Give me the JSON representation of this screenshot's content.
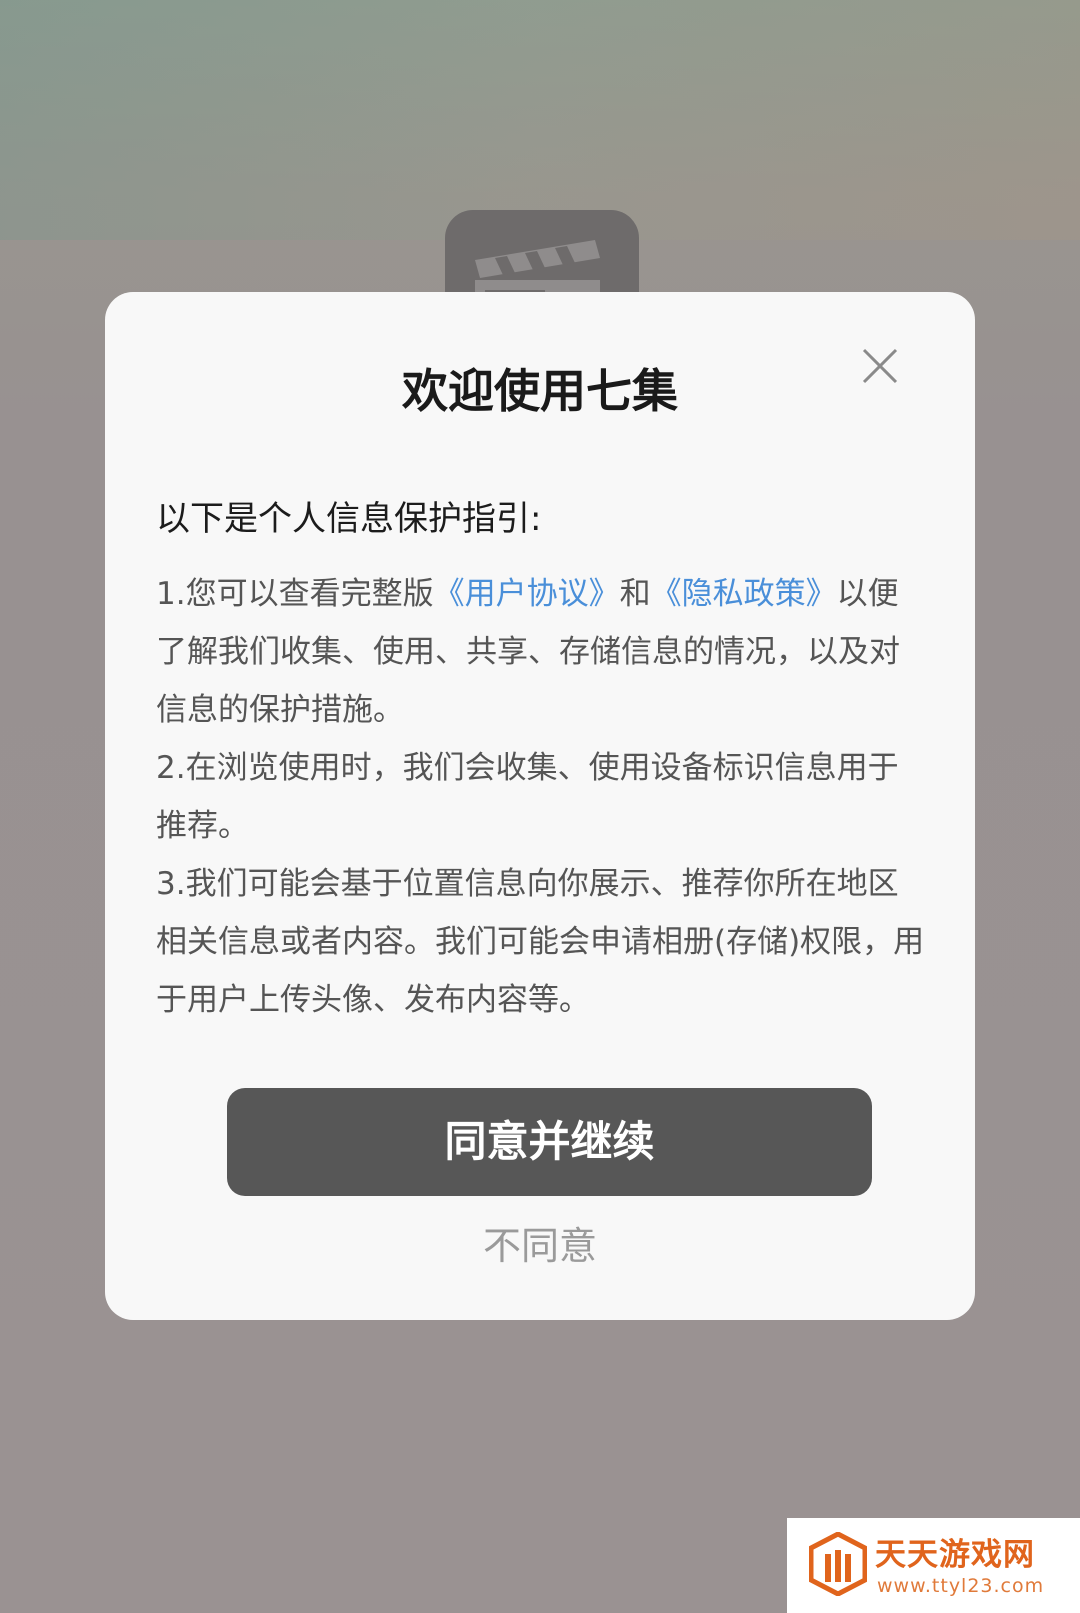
{
  "dialog": {
    "title": "欢迎使用七集",
    "close_icon": "close-icon",
    "intro": "以下是个人信息保护指引:",
    "item1": {
      "prefix": "1.您可以查看完整版",
      "user_agreement_link": "《用户协议》",
      "and": "和",
      "privacy_policy_link": "《隐私政策》",
      "suffix": "以便了解我们收集、使用、共享、存储信息的情况，以及对信息的保护措施。"
    },
    "item2": "2.在浏览使用时，我们会收集、使用设备标识信息用于推荐。",
    "item3": "3.我们可能会基于位置信息向你展示、推荐你所在地区相关信息或者内容。我们可能会申请相册(存储)权限，用于用户上传头像、发布内容等。",
    "agree_label": "同意并继续",
    "decline_label": "不同意"
  },
  "background": {
    "app_icon": "clapperboard-icon"
  },
  "watermark": {
    "name": "天天游戏网",
    "url": "www.ttyl23.com"
  },
  "colors": {
    "link": "#4a8fd9",
    "agree_button": "#575757",
    "decline_text": "#9a9a9a",
    "watermark": "#e0641c"
  }
}
